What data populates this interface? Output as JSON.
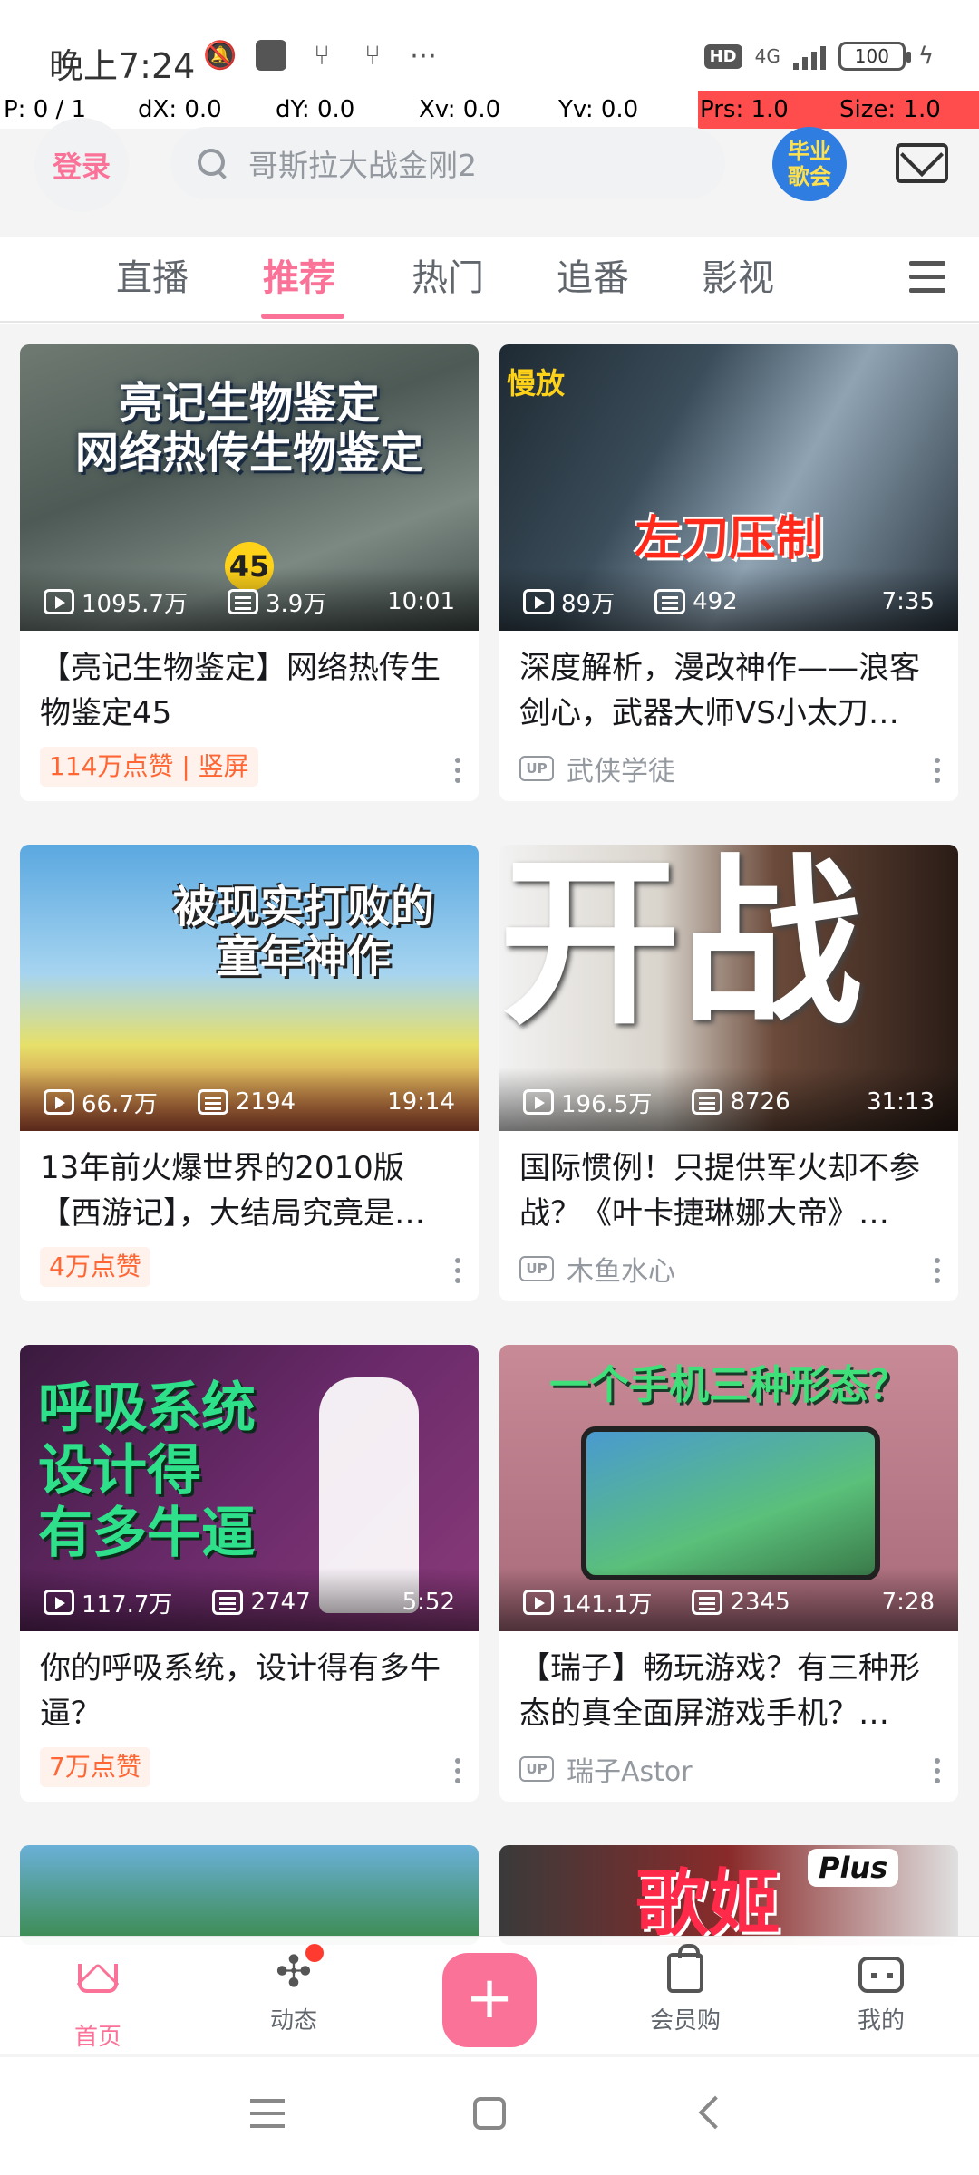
{
  "status_bar": {
    "time": "晚上7:24",
    "net": "4G",
    "battery": "100"
  },
  "debug": {
    "p": "P: 0 / 1",
    "dx": "dX: 0.0",
    "dy": "dY: 0.0",
    "xv": "Xv: 0.0",
    "yv": "Yv: 0.0",
    "prs": "Prs: 1.0",
    "size": "Size: 1.0"
  },
  "header": {
    "login_label": "登录",
    "search_placeholder": "哥斯拉大战金刚2",
    "promo_badge": "毕业\n歌会"
  },
  "tabs": [
    {
      "label": "直播"
    },
    {
      "label": "推荐"
    },
    {
      "label": "热门"
    },
    {
      "label": "追番"
    },
    {
      "label": "影视"
    }
  ],
  "cards": [
    {
      "thumb_text": "亮记生物鉴定\n网络热传生物鉴定",
      "views": "1095.7万",
      "danmaku": "3.9万",
      "duration": "10:01",
      "title": "【亮记生物鉴定】网络热传生物鉴定45",
      "badge": "114万点赞 | 竖屏"
    },
    {
      "thumb_text": "左刀压制",
      "thumb_tag": "慢放",
      "views": "89万",
      "danmaku": "492",
      "duration": "7:35",
      "title": "深度解析，漫改神作——浪客剑心，武器大师VS小太刀…",
      "uploader": "武侠学徒"
    },
    {
      "thumb_text": "被现实打败的\n童年神作",
      "views": "66.7万",
      "danmaku": "2194",
      "duration": "19:14",
      "title": "13年前火爆世界的2010版【西游记】，大结局究竟是…",
      "badge": "4万点赞"
    },
    {
      "thumb_text": "开战",
      "views": "196.5万",
      "danmaku": "8726",
      "duration": "31:13",
      "title": "国际惯例！只提供军火却不参战？《叶卡捷琳娜大帝》…",
      "uploader": "木鱼水心"
    },
    {
      "thumb_text": "呼吸系统\n设计得\n有多牛逼",
      "views": "117.7万",
      "danmaku": "2747",
      "duration": "5:52",
      "title": "你的呼吸系统，设计得有多牛逼？",
      "badge": "7万点赞"
    },
    {
      "thumb_text": "一个手机三种形态？",
      "views": "141.1万",
      "danmaku": "2345",
      "duration": "7:28",
      "title": "【瑞子】畅玩游戏？有三种形态的真全面屏游戏手机？…",
      "uploader": "瑞子Astor"
    }
  ],
  "partial_cards": [
    {
      "thumb_text": ""
    },
    {
      "thumb_text": "歌姬",
      "thumb_tag": "Plus"
    }
  ],
  "bottom_nav": [
    {
      "label": "首页"
    },
    {
      "label": "动态"
    },
    {
      "label": "会员购"
    },
    {
      "label": "我的"
    }
  ],
  "add_label": "+",
  "up_tag": "UP",
  "colors": {
    "accent": "#fb7299",
    "likes": "#ff6633",
    "promo": "#2f7de1"
  }
}
